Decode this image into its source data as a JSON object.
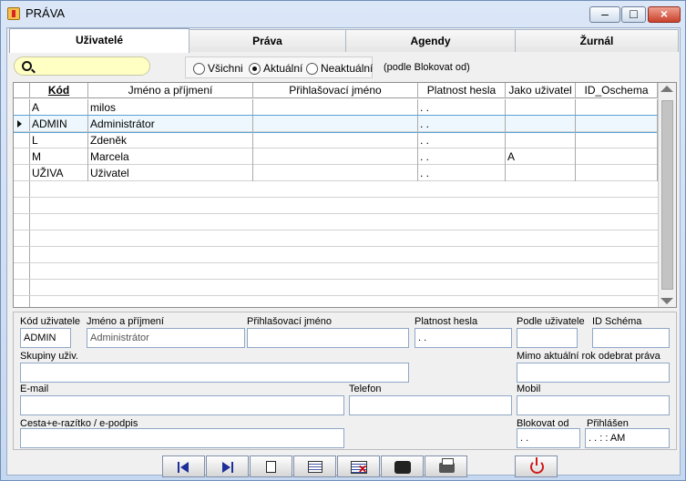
{
  "window": {
    "title": "PRÁVA"
  },
  "tabs": [
    {
      "label": "Uživatelé",
      "active": true
    },
    {
      "label": "Práva",
      "active": false
    },
    {
      "label": "Agendy",
      "active": false
    },
    {
      "label": "Žurnál",
      "active": false
    }
  ],
  "filters": {
    "options": [
      "Všichni",
      "Aktuální",
      "Neaktuální"
    ],
    "selected": "Aktuální",
    "note": "(podle Blokovat od)"
  },
  "table": {
    "columns": [
      "Kód",
      "Jméno a příjmení",
      "Přihlašovací jméno",
      "Platnost hesla",
      "Jako uživatel",
      "ID_Oschema"
    ],
    "rows": [
      {
        "kod": "A",
        "jmeno": "milos",
        "login": "",
        "platnost": ". .",
        "jako": "",
        "id": ""
      },
      {
        "kod": "ADMIN",
        "jmeno": "Administrátor",
        "login": "",
        "platnost": ". .",
        "jako": "",
        "id": ""
      },
      {
        "kod": "L",
        "jmeno": "Zdeněk",
        "login": "",
        "platnost": ". .",
        "jako": "",
        "id": ""
      },
      {
        "kod": "M",
        "jmeno": "Marcela",
        "login": "",
        "platnost": ". .",
        "jako": "A",
        "id": ""
      },
      {
        "kod": "UŽIVA",
        "jmeno": "Uživatel",
        "login": "",
        "platnost": ". .",
        "jako": "",
        "id": ""
      }
    ],
    "selected_index": 1
  },
  "details": {
    "kod_label": "Kód uživatele",
    "kod_value": "ADMIN",
    "jmeno_label": "Jméno a příjmení",
    "jmeno_value": "Administrátor",
    "login_label": "Přihlašovací jméno",
    "login_value": "",
    "platnost_label": "Platnost hesla",
    "platnost_value": ". .",
    "podle_label": "Podle uživatele",
    "podle_value": "",
    "id_label": "ID Schéma",
    "id_value": "",
    "skupiny_label": "Skupiny uživ.",
    "skupiny_value": "",
    "mimo_label": "Mimo aktuální rok odebrat práva",
    "mimo_value": "",
    "email_label": "E-mail",
    "email_value": "",
    "telefon_label": "Telefon",
    "telefon_value": "",
    "mobil_label": "Mobil",
    "mobil_value": "",
    "cesta_label": "Cesta+e-razítko / e-podpis",
    "cesta_value": "",
    "blokovat_label": "Blokovat od",
    "blokovat_value": ". .",
    "prihlasen_label": "Přihlášen",
    "prihlasen_value": ". .   : :  AM"
  },
  "toolbar": {
    "buttons": [
      "first-record",
      "last-record",
      "new-record",
      "edit-record",
      "delete-record",
      "find-record",
      "print",
      "exit"
    ]
  }
}
